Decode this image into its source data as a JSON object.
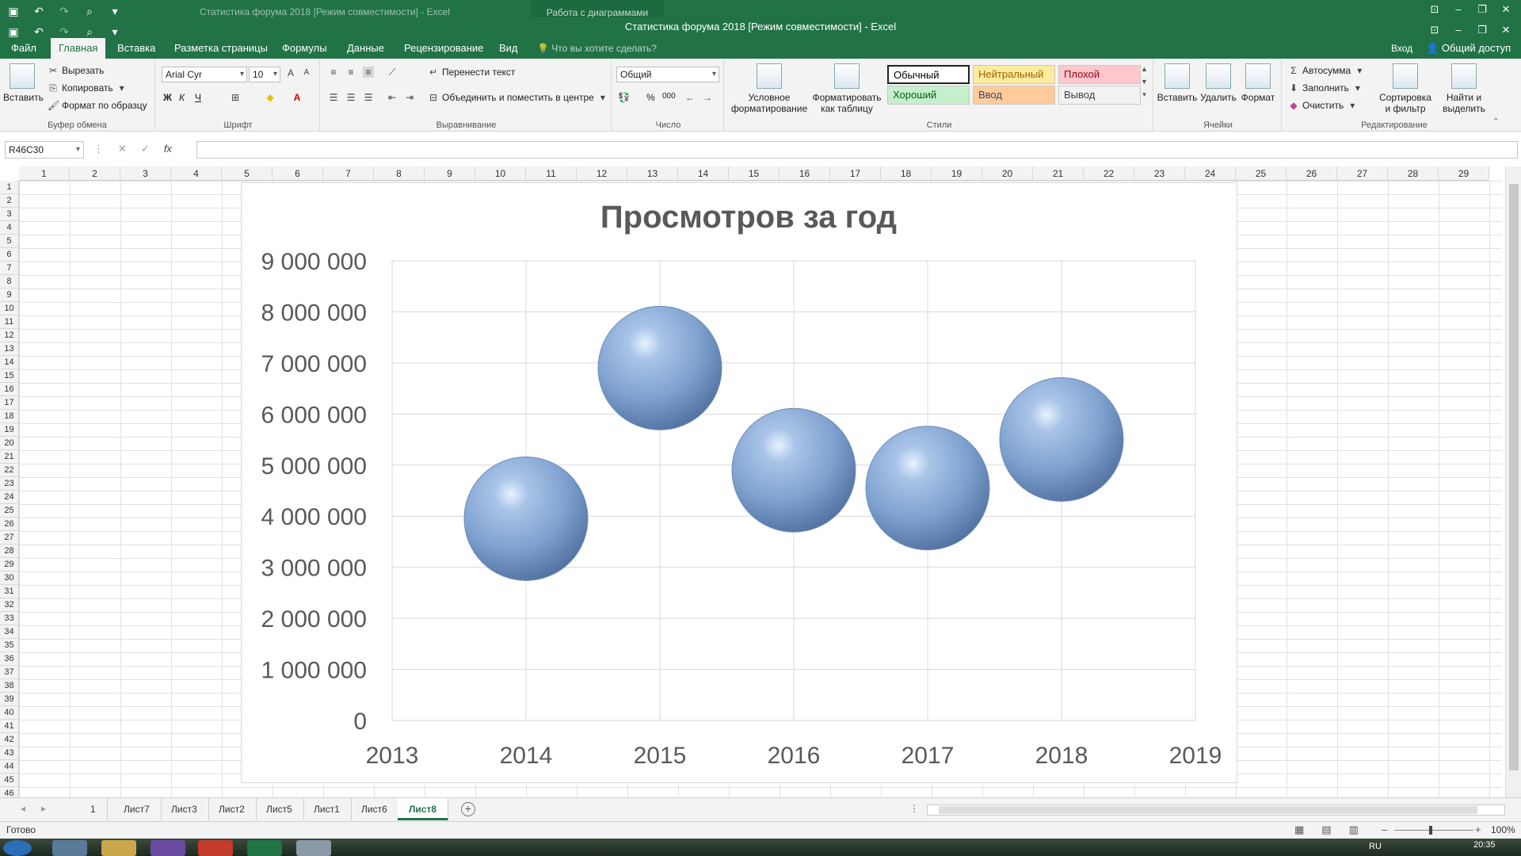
{
  "window": {
    "title": "Статистика форума 2018  [Режим совместимости] - Excel",
    "title_ghost": "Статистика форума 2018  [Режим совместимости] - Excel",
    "context_tab": "Работа с диаграммами"
  },
  "menu": {
    "tabs": [
      "Файл",
      "Главная",
      "Вставка",
      "Разметка страницы",
      "Формулы",
      "Данные",
      "Рецензирование",
      "Вид"
    ],
    "active": "Главная",
    "tell_me": "Что вы хотите сделать?",
    "login": "Вход",
    "share": "Общий доступ"
  },
  "ribbon": {
    "clipboard": {
      "paste": "Вставить",
      "cut": "Вырезать",
      "copy": "Копировать",
      "format_painter": "Формат по образцу",
      "label": "Буфер обмена"
    },
    "font": {
      "name": "Arial Cyr",
      "size": "10",
      "bold": "Ж",
      "italic": "К",
      "underline": "Ч",
      "label": "Шрифт"
    },
    "alignment": {
      "wrap": "Перенести текст",
      "merge": "Объединить и поместить в центре",
      "label": "Выравнивание"
    },
    "number": {
      "format": "Общий",
      "percent": "%",
      "thousands": "000",
      "label": "Число"
    },
    "styles": {
      "conditional": "Условное форматирование",
      "as_table": "Форматировать как таблицу",
      "cells": [
        {
          "text": "Обычный",
          "bg": "#ffffff",
          "fg": "#000000"
        },
        {
          "text": "Нейтральный",
          "bg": "#ffeb9c",
          "fg": "#9c6500"
        },
        {
          "text": "Плохой",
          "bg": "#ffc7ce",
          "fg": "#9c0006"
        },
        {
          "text": "Хороший",
          "bg": "#c6efce",
          "fg": "#006100"
        },
        {
          "text": "Ввод",
          "bg": "#ffcc99",
          "fg": "#3f3f76"
        },
        {
          "text": "Вывод",
          "bg": "#f2f2f2",
          "fg": "#3f3f3f"
        }
      ],
      "label": "Стили"
    },
    "cells": {
      "insert": "Вставить",
      "delete": "Удалить",
      "format": "Формат",
      "label": "Ячейки"
    },
    "editing": {
      "autosum": "Автосумма",
      "fill": "Заполнить",
      "clear": "Очистить",
      "sort": "Сортировка и фильтр",
      "find": "Найти и выделить",
      "label": "Редактирование"
    }
  },
  "formula_bar": {
    "name_box": "R46C30",
    "fx": "fx",
    "value": ""
  },
  "grid": {
    "columns": [
      "1",
      "2",
      "3",
      "4",
      "5",
      "6",
      "7",
      "8",
      "9",
      "10",
      "11",
      "12",
      "13",
      "14",
      "15",
      "16",
      "17",
      "18",
      "19",
      "20",
      "21",
      "22",
      "23",
      "24",
      "25",
      "26",
      "27",
      "28",
      "29"
    ],
    "rows": [
      "1",
      "2",
      "3",
      "4",
      "5",
      "6",
      "7",
      "8",
      "9",
      "10",
      "11",
      "12",
      "13",
      "14",
      "15",
      "16",
      "17",
      "18",
      "19",
      "20",
      "21",
      "22",
      "23",
      "24",
      "25",
      "26",
      "27",
      "28",
      "29",
      "30",
      "31",
      "32",
      "33",
      "34",
      "35",
      "36",
      "37",
      "38",
      "39",
      "40",
      "41",
      "42",
      "43",
      "44",
      "45",
      "46"
    ]
  },
  "chart_data": {
    "type": "scatter",
    "title": "Просмотров за год",
    "x": [
      2014,
      2015,
      2016,
      2017,
      2018
    ],
    "values": [
      3950000,
      6900000,
      4900000,
      4550000,
      5500000
    ],
    "xlim": [
      2013,
      2019
    ],
    "ylim": [
      0,
      9000000
    ],
    "xticks": [
      "2013",
      "2014",
      "2015",
      "2016",
      "2017",
      "2018",
      "2019"
    ],
    "yticks": [
      "0",
      "1 000 000",
      "2 000 000",
      "3 000 000",
      "4 000 000",
      "5 000 000",
      "6 000 000",
      "7 000 000",
      "8 000 000",
      "9 000 000"
    ],
    "grid": true,
    "marker_color": "#7ea1cf"
  },
  "sheets": {
    "tabs": [
      "1",
      "Лист7",
      "Лист3",
      "Лист2",
      "Лист5",
      "Лист1",
      "Лист6",
      "Лист8"
    ],
    "active": "Лист8"
  },
  "status": {
    "ready": "Готово",
    "zoom": "100%"
  },
  "taskbar": {
    "lang": "RU",
    "clock": "20:35"
  }
}
